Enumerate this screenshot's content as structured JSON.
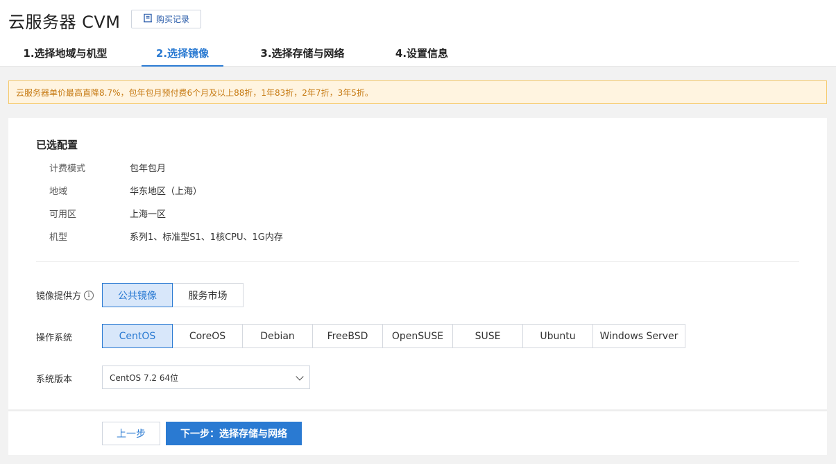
{
  "header": {
    "title": "云服务器 CVM",
    "history_button": "购买记录",
    "history_icon": "book-icon"
  },
  "steps": [
    {
      "label": "1.选择地域与机型"
    },
    {
      "label": "2.选择镜像",
      "active": true
    },
    {
      "label": "3.选择存储与网络"
    },
    {
      "label": "4.设置信息"
    }
  ],
  "notice": "云服务器单价最高直降8.7%，包年包月预付费6个月及以上88折，1年83折，2年7折，3年5折。",
  "config": {
    "title": "已选配置",
    "rows": [
      {
        "label": "计费模式",
        "value": "包年包月"
      },
      {
        "label": "地域",
        "value": "华东地区（上海）"
      },
      {
        "label": "可用区",
        "value": "上海一区"
      },
      {
        "label": "机型",
        "value": "系列1、标准型S1、1核CPU、1G内存"
      }
    ]
  },
  "image_provider": {
    "label": "镜像提供方",
    "info_icon": "i",
    "options": [
      "公共镜像",
      "服务市场"
    ],
    "selected": "公共镜像"
  },
  "os": {
    "label": "操作系统",
    "options": [
      "CentOS",
      "CoreOS",
      "Debian",
      "FreeBSD",
      "OpenSUSE",
      "SUSE",
      "Ubuntu",
      "Windows Server"
    ],
    "selected": "CentOS"
  },
  "version": {
    "label": "系统版本",
    "value": "CentOS 7.2 64位"
  },
  "footer": {
    "prev": "上一步",
    "next": "下一步：选择存储与网络"
  },
  "colors": {
    "accent": "#2a7ad2",
    "notice_bg": "#fff4e0",
    "notice_text": "#c67a13"
  }
}
